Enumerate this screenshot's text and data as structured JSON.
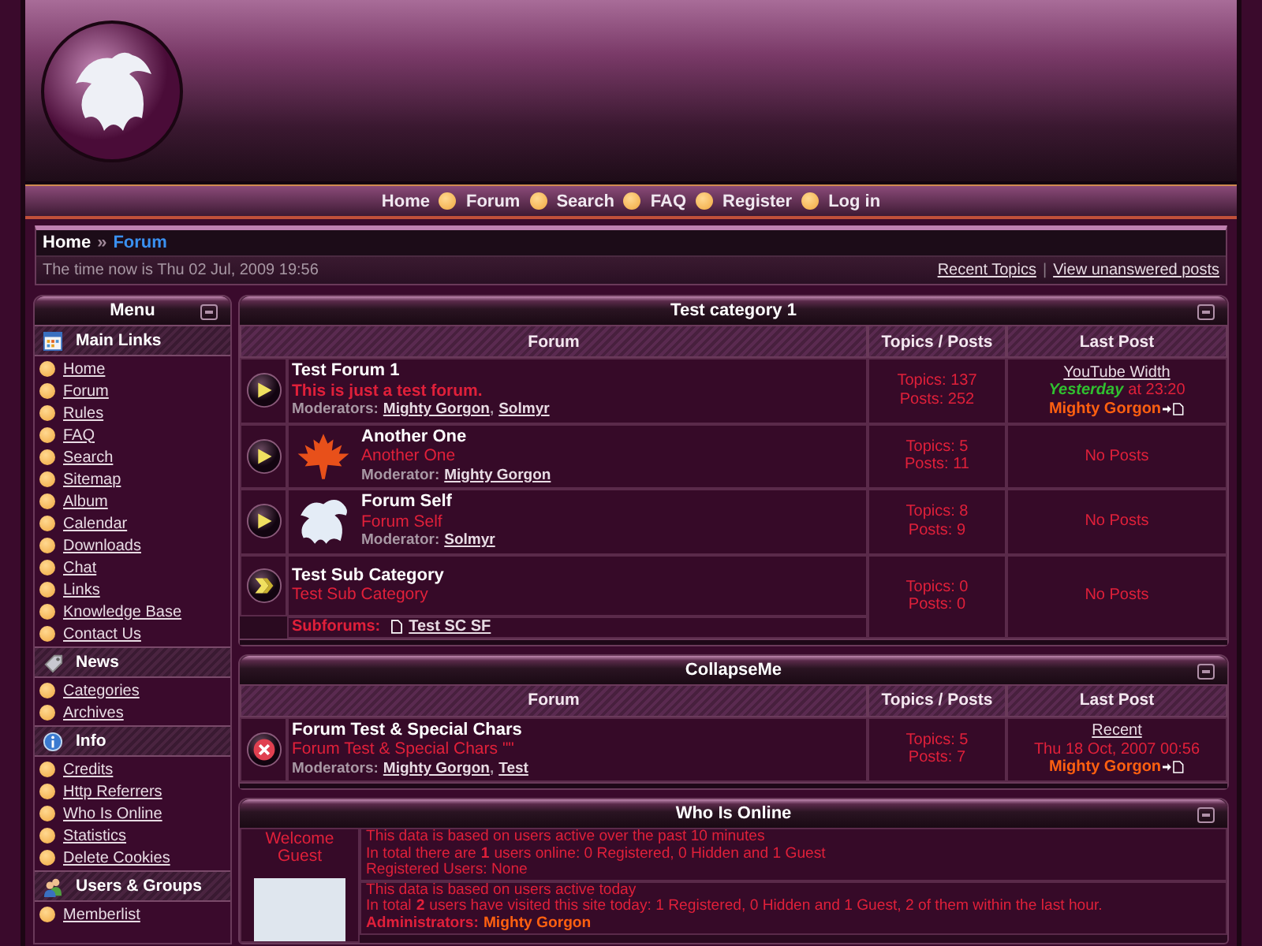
{
  "nav": [
    "Home",
    "Forum",
    "Search",
    "FAQ",
    "Register",
    "Log in"
  ],
  "breadcrumb": {
    "home": "Home",
    "separator": "»",
    "current": "Forum"
  },
  "time": "The time now is Thu 02 Jul, 2009 19:56",
  "quick_links": [
    "Recent Topics",
    "View unanswered posts"
  ],
  "quick_links_separator": "|",
  "menu": {
    "title": "Menu",
    "sections": [
      {
        "title": "Main Links",
        "kind": "grid",
        "items": [
          "Home",
          "Forum",
          "Rules",
          "FAQ",
          "Search",
          "Sitemap",
          "Album",
          "Calendar",
          "Downloads",
          "Chat",
          "Links",
          "Knowledge Base",
          "Contact Us"
        ]
      },
      {
        "title": "News",
        "kind": "tag",
        "items": [
          "Categories",
          "Archives"
        ]
      },
      {
        "title": "Info",
        "kind": "info",
        "items": [
          "Credits",
          "Http Referrers",
          "Who Is Online",
          "Statistics",
          "Delete Cookies"
        ]
      },
      {
        "title": "Users & Groups",
        "kind": "users",
        "items": [
          "Memberlist"
        ]
      }
    ]
  },
  "categories": [
    {
      "title": "Test category 1",
      "columns": [
        "Forum",
        "Topics / Posts",
        "Last Post"
      ],
      "forums": [
        {
          "kind": "forum",
          "name": "Test Forum 1",
          "description": "This is just a test forum.",
          "description_bold": true,
          "moderators_label": "Moderators:",
          "moderators": [
            "Mighty Gorgon",
            "Solmyr"
          ],
          "topics": "Topics: 137",
          "posts": "Posts: 252",
          "last_post": {
            "link": "YouTube Width",
            "day": "Yesterday",
            "time": "at 23:20",
            "author": "Mighty Gorgon"
          }
        },
        {
          "kind": "forum",
          "name": "Another One",
          "description": "Another One",
          "description_bold": false,
          "moderators_label": "Moderator:",
          "moderators": [
            "Mighty Gorgon"
          ],
          "topics": "Topics: 5",
          "posts": "Posts: 11",
          "last_post": {
            "text": "No Posts"
          }
        },
        {
          "kind": "forum",
          "name": "Forum Self",
          "description": "Forum Self",
          "description_bold": false,
          "moderators_label": "Moderator:",
          "moderators": [
            "Solmyr"
          ],
          "topics": "Topics: 8",
          "posts": "Posts: 9",
          "last_post": {
            "text": "No Posts"
          }
        },
        {
          "kind": "subcategory",
          "name": "Test Sub Category",
          "description": "Test Sub Category",
          "description_bold": false,
          "subforums_label": "Subforums:",
          "subforums": [
            "Test SC SF"
          ],
          "topics": "Topics: 0",
          "posts": "Posts: 0",
          "last_post": {
            "text": "No Posts"
          }
        }
      ]
    },
    {
      "title": "CollapseMe",
      "columns": [
        "Forum",
        "Topics / Posts",
        "Last Post"
      ],
      "forums": [
        {
          "kind": "locked",
          "name": "Forum Test & Special Chars",
          "description": "Forum Test & Special Chars \"\"",
          "description_bold": false,
          "moderators_label": "Moderators:",
          "moderators": [
            "Mighty Gorgon",
            "Test"
          ],
          "topics": "Topics: 5",
          "posts": "Posts: 7",
          "last_post": {
            "link": "Recent",
            "time": "Thu 18 Oct, 2007 00:56",
            "author": "Mighty Gorgon"
          }
        }
      ]
    }
  ],
  "list_separator": ",",
  "online": {
    "title": "Who Is Online",
    "welcome": "Welcome Guest",
    "blocks": [
      [
        "This data is based on users active over the past 10 minutes",
        "In total there are **1** users online: 0 Registered, 0 Hidden and 1 Guest",
        "Registered Users: None"
      ],
      [
        "This data is based on users active today",
        "In total **2** users have visited this site today: 1 Registered, 0 Hidden and 1 Guest, 2 of them within the last hour."
      ]
    ],
    "admins_label": "Administrators:",
    "admins": "Mighty Gorgon"
  }
}
